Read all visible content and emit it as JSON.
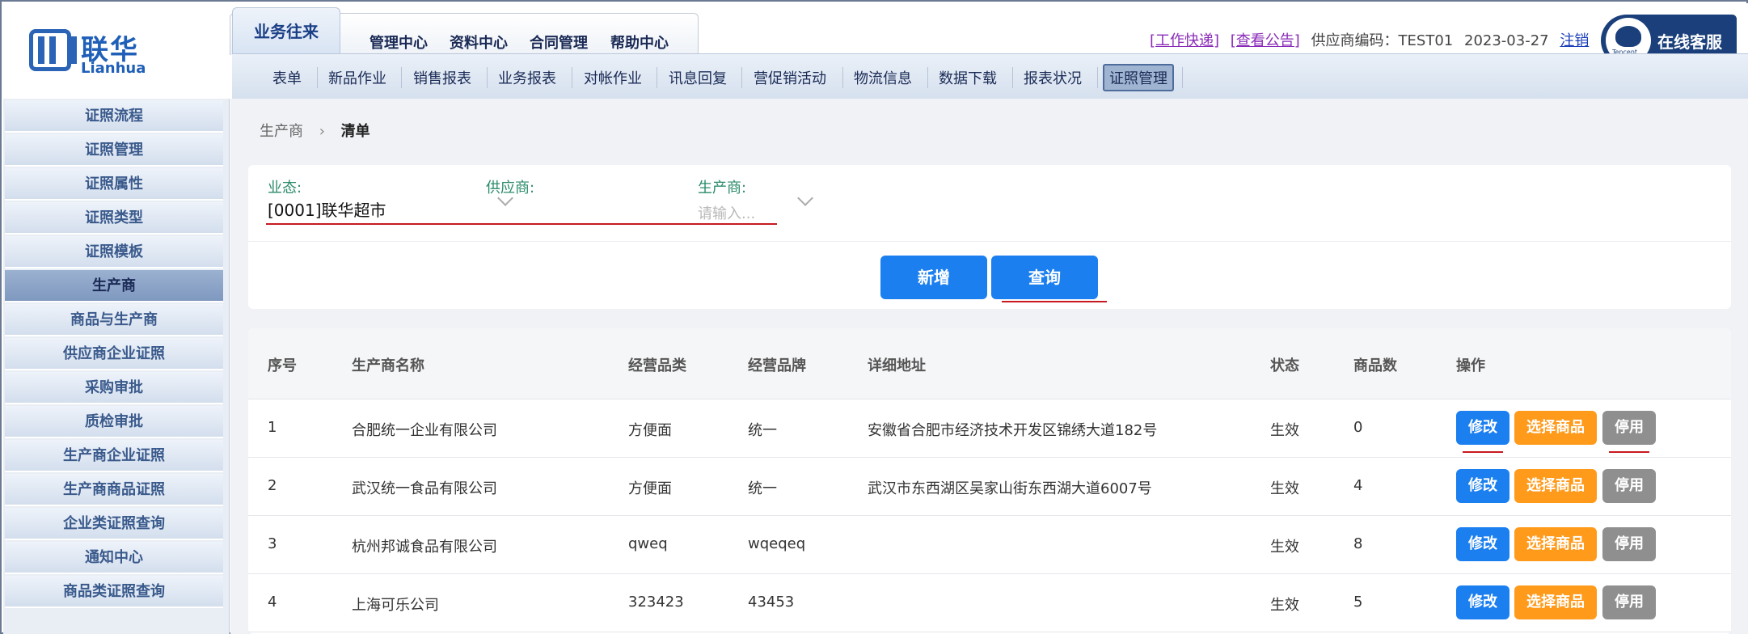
{
  "logo": {
    "cn": "联华",
    "en": "Lianhua"
  },
  "main_tabs": [
    "业务往来",
    "管理中心",
    "资料中心",
    "合同管理",
    "帮助中心"
  ],
  "top_bar": {
    "work_express": "[工作快递]",
    "view_notice": "[查看公告]",
    "supplier_code": "供应商编码：TEST01",
    "date": "2023-03-27",
    "logout": "注销"
  },
  "service": {
    "label": "在线客服"
  },
  "subnav": [
    "表单",
    "新品作业",
    "销售报表",
    "业务报表",
    "对帐作业",
    "讯息回复",
    "营促销活动",
    "物流信息",
    "数据下载",
    "报表状况",
    "证照管理"
  ],
  "sidebar": [
    "证照流程",
    "证照管理",
    "证照属性",
    "证照类型",
    "证照模板",
    "生产商",
    "商品与生产商",
    "供应商企业证照",
    "采购审批",
    "质检审批",
    "生产商企业证照",
    "生产商商品证照",
    "企业类证照查询",
    "通知中心",
    "商品类证照查询"
  ],
  "breadcrumb": {
    "parent": "生产商",
    "current": "清单"
  },
  "filters": {
    "format_label": "业态:",
    "format_value": "[0001]联华超市",
    "supplier_label": "供应商:",
    "producer_label": "生产商:",
    "producer_placeholder": "请输入..."
  },
  "buttons": {
    "add": "新增",
    "query": "查询"
  },
  "table": {
    "headers": [
      "序号",
      "生产商名称",
      "经营品类",
      "经营品牌",
      "详细地址",
      "状态",
      "商品数",
      "操作"
    ],
    "actions": {
      "edit": "修改",
      "select": "选择商品",
      "disable": "停用"
    },
    "rows": [
      {
        "no": "1",
        "name": "合肥统一企业有限公司",
        "category": "方便面",
        "brand": "统一",
        "address": "安徽省合肥市经济技术开发区锦绣大道182号",
        "status": "生效",
        "count": "0"
      },
      {
        "no": "2",
        "name": "武汉统一食品有限公司",
        "category": "方便面",
        "brand": "统一",
        "address": "武汉市东西湖区吴家山街东西湖大道6007号",
        "status": "生效",
        "count": "4"
      },
      {
        "no": "3",
        "name": "杭州邦诚食品有限公司",
        "category": "qweq",
        "brand": "wqeqeq",
        "address": "",
        "status": "生效",
        "count": "8"
      },
      {
        "no": "4",
        "name": "上海可乐公司",
        "category": "323423",
        "brand": "43453",
        "address": "",
        "status": "生效",
        "count": "5"
      }
    ]
  },
  "colors": {
    "primary": "#1b7ff0",
    "warning": "#ff9a1a",
    "muted": "#8f8f8f",
    "annotation_red": "#c8191f"
  }
}
